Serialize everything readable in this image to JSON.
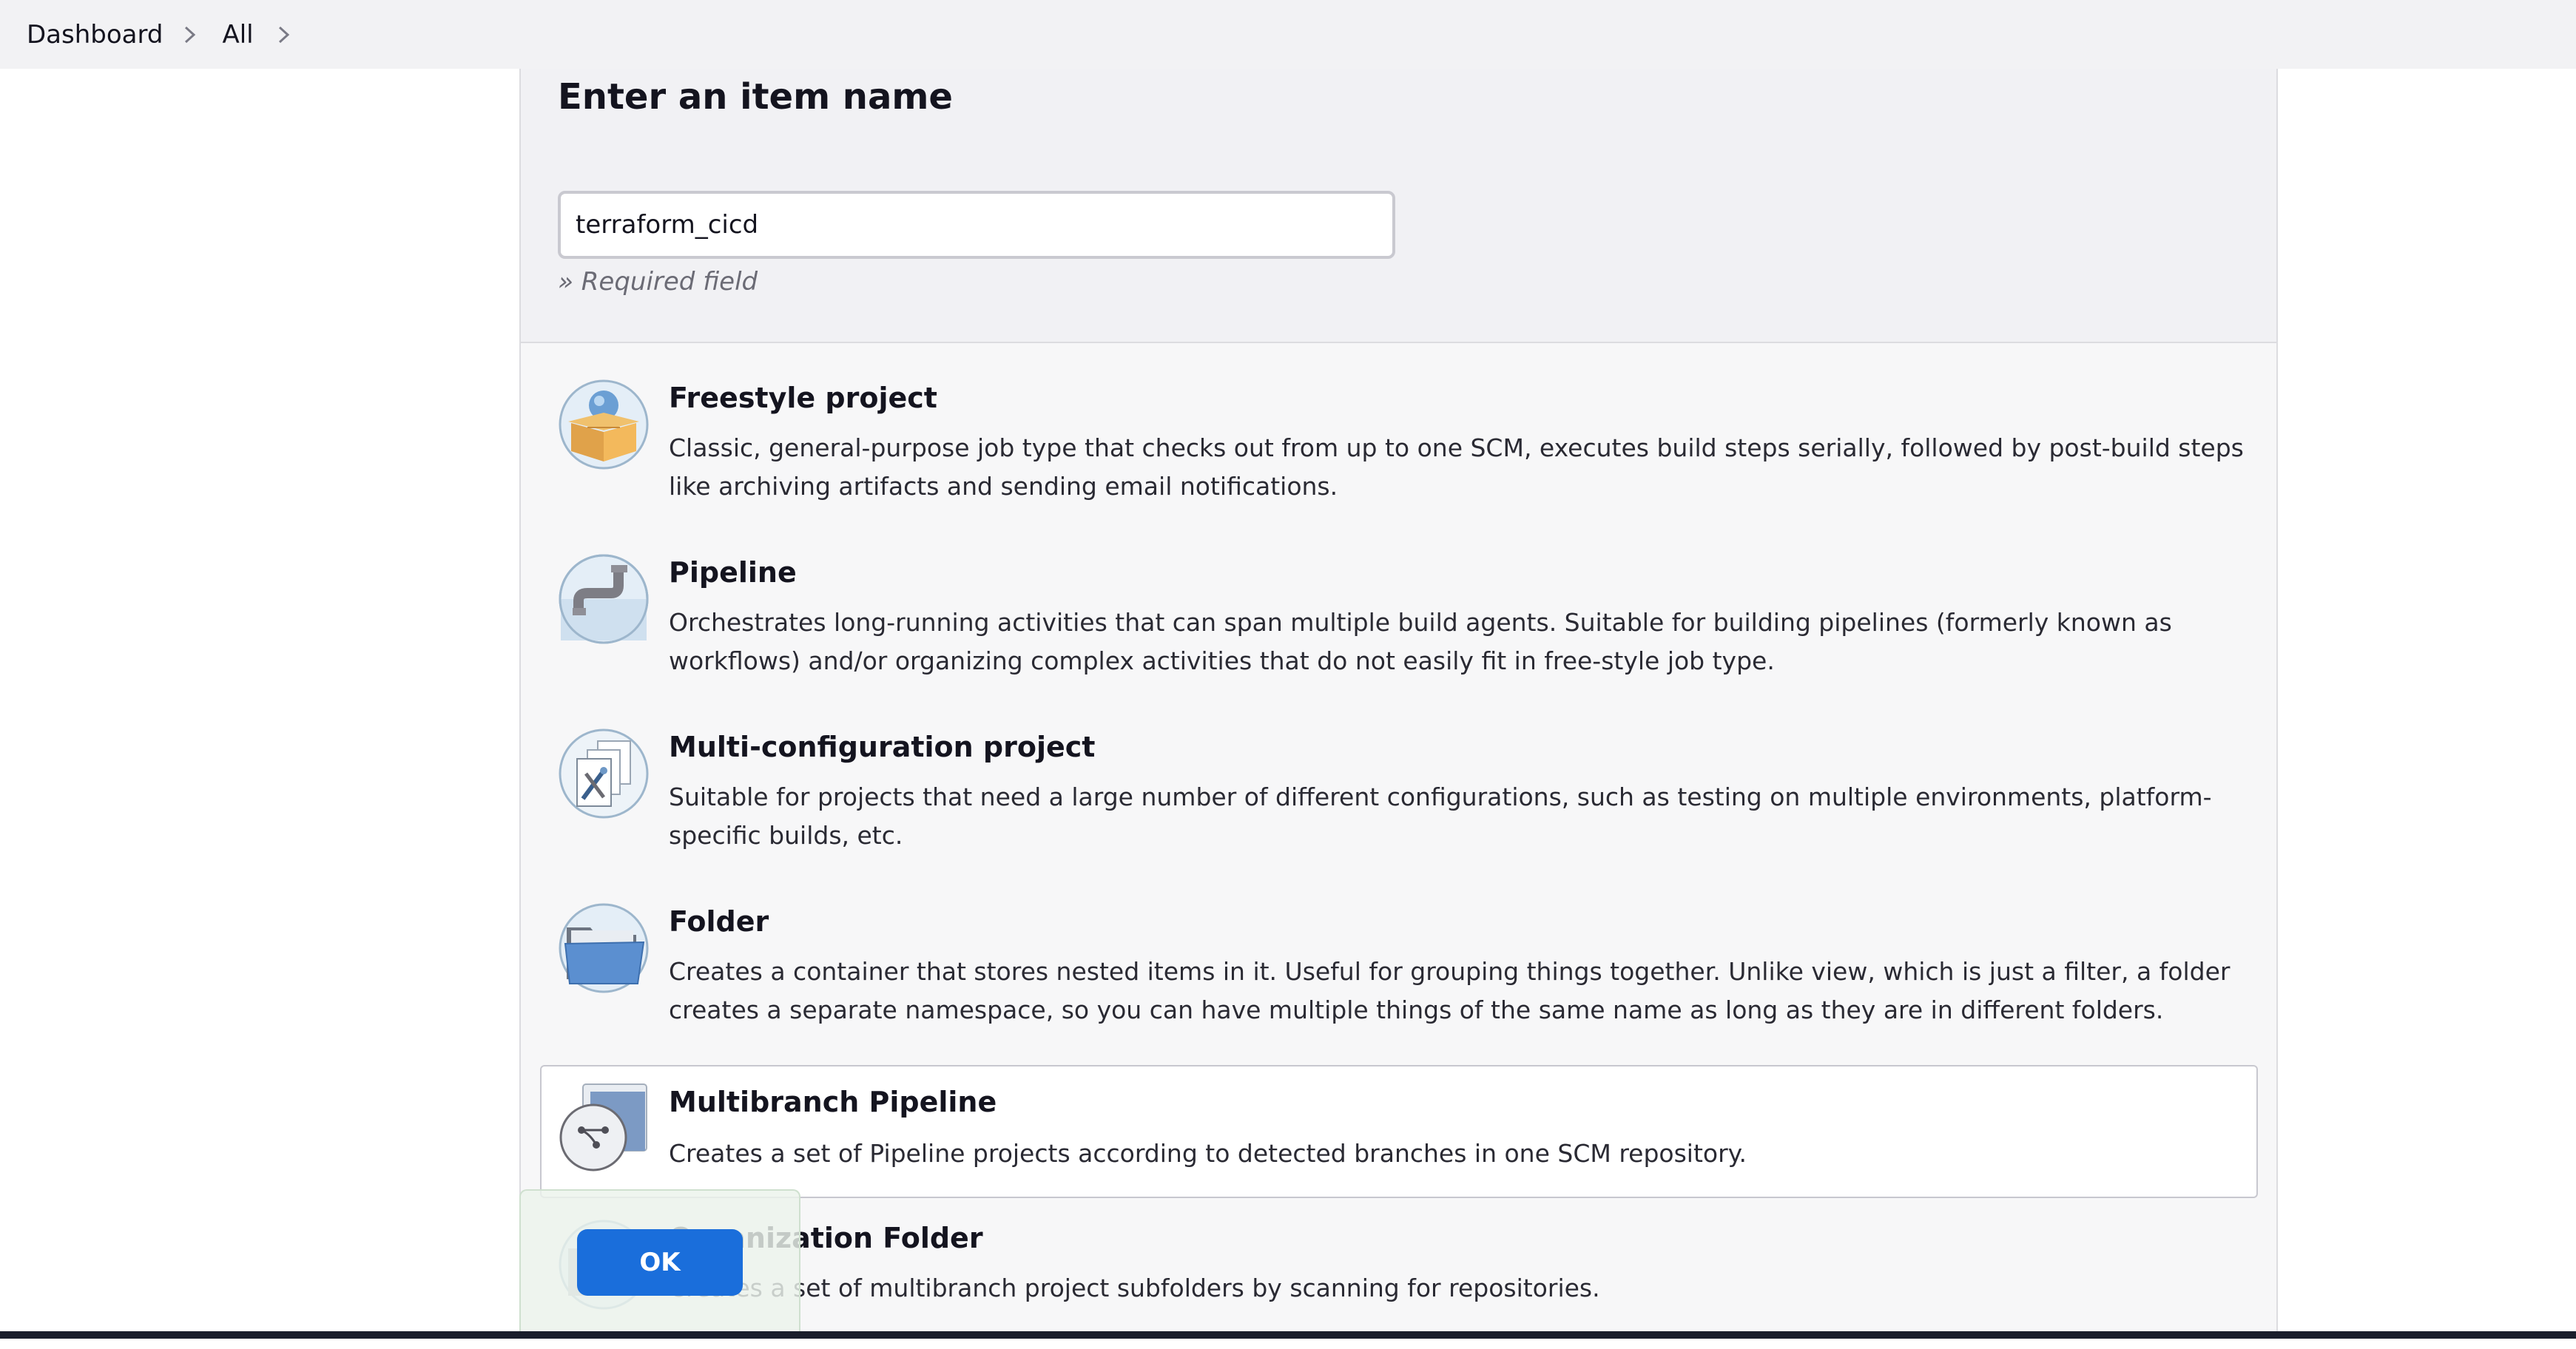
{
  "breadcrumb": {
    "items": [
      {
        "label": "Dashboard"
      },
      {
        "label": "All"
      }
    ]
  },
  "form": {
    "heading": "Enter an item name",
    "item_name_value": "terraform_cicd",
    "required_note": "» Required field"
  },
  "item_types": [
    {
      "icon": "freestyle-project-icon",
      "title": "Freestyle project",
      "description": "Classic, general-purpose job type that checks out from up to one SCM, executes build steps serially, followed by post-build steps like archiving artifacts and sending email notifications."
    },
    {
      "icon": "pipeline-icon",
      "title": "Pipeline",
      "description": "Orchestrates long-running activities that can span multiple build agents. Suitable for building pipelines (formerly known as workflows) and/or organizing complex activities that do not easily fit in free-style job type."
    },
    {
      "icon": "multi-configuration-project-icon",
      "title": "Multi-configuration project",
      "description": "Suitable for projects that need a large number of different configurations, such as testing on multiple environments, platform-specific builds, etc."
    },
    {
      "icon": "folder-icon",
      "title": "Folder",
      "description": "Creates a container that stores nested items in it. Useful for grouping things together. Unlike view, which is just a filter, a folder creates a separate namespace, so you can have multiple things of the same name as long as they are in different folders."
    },
    {
      "icon": "multibranch-pipeline-icon",
      "title": "Multibranch Pipeline",
      "description": "Creates a set of Pipeline projects according to detected branches in one SCM repository.",
      "selected": true
    },
    {
      "icon": "organization-folder-icon",
      "title": "Organization Folder",
      "description": "Creates a set of multibranch project subfolders by scanning for repositories."
    }
  ],
  "actions": {
    "ok_label": "OK"
  },
  "colors": {
    "accent": "#1a6edb",
    "panel_background": "#f7f7f8",
    "selected_item_border": "#c8c8cf"
  }
}
